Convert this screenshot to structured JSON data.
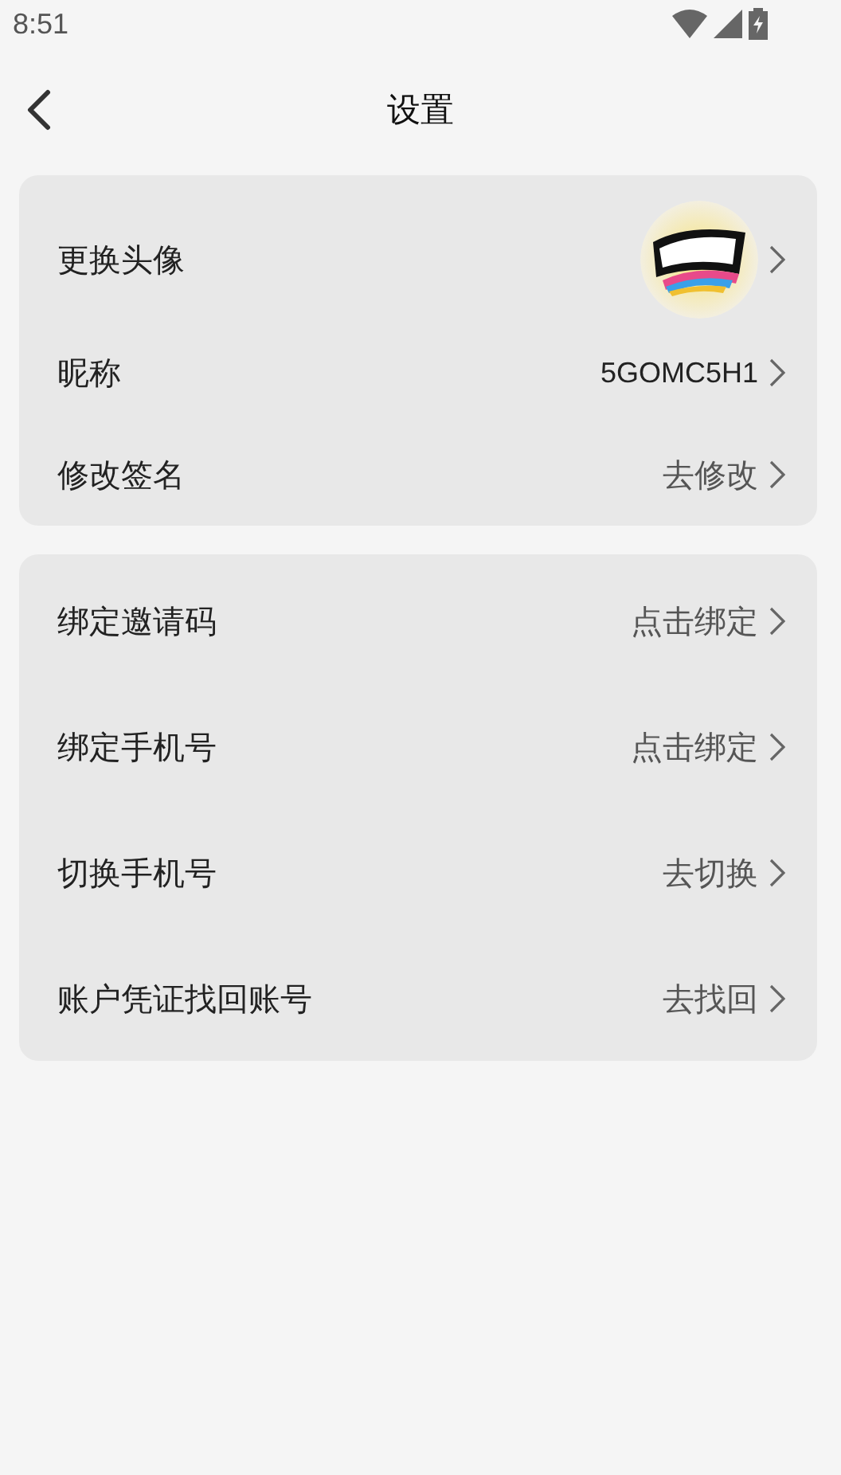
{
  "status_bar": {
    "time": "8:51"
  },
  "header": {
    "title": "设置"
  },
  "groups": [
    {
      "rows": [
        {
          "kind": "avatar",
          "label": "更换头像"
        },
        {
          "kind": "value",
          "label": "昵称",
          "value": "5GOMC5H1"
        },
        {
          "kind": "action",
          "label": "修改签名",
          "value": "去修改"
        }
      ]
    },
    {
      "rows": [
        {
          "kind": "action",
          "label": "绑定邀请码",
          "value": "点击绑定"
        },
        {
          "kind": "action",
          "label": "绑定手机号",
          "value": "点击绑定"
        },
        {
          "kind": "action",
          "label": "切换手机号",
          "value": "去切换"
        },
        {
          "kind": "action",
          "label": "账户凭证找回账号",
          "value": "去找回"
        }
      ]
    }
  ]
}
